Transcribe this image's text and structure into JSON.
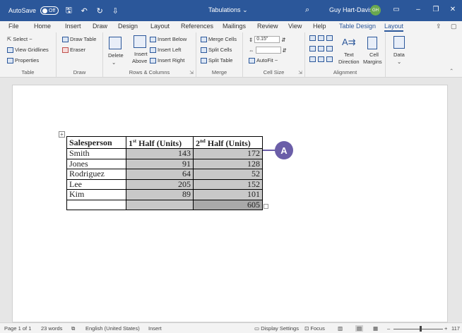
{
  "titlebar": {
    "autosave_label": "AutoSave",
    "autosave_state": "Off",
    "doc_title": "Tabulations",
    "title_suffix": "⌄",
    "user_name": "Guy Hart-Davis",
    "user_initials": "GH",
    "icons": [
      "save-icon",
      "undo-icon",
      "redo-icon",
      "customize-icon"
    ]
  },
  "menu": {
    "tabs": [
      "File",
      "Home",
      "Insert",
      "Draw",
      "Design",
      "Layout",
      "References",
      "Mailings",
      "Review",
      "View",
      "Help",
      "Table Design",
      "Layout"
    ],
    "active_index": 12
  },
  "ribbon": {
    "table": {
      "label": "Table",
      "select": "Select ~",
      "view_gridlines": "View Gridlines",
      "properties": "Properties"
    },
    "draw": {
      "label": "Draw",
      "draw_table": "Draw Table",
      "eraser": "Eraser"
    },
    "rows_columns": {
      "label": "Rows & Columns",
      "delete": "Delete",
      "insert_above_1": "Insert",
      "insert_above_2": "Above",
      "insert_below": "Insert Below",
      "insert_left": "Insert Left",
      "insert_right": "Insert Right"
    },
    "merge": {
      "label": "Merge",
      "merge_cells": "Merge Cells",
      "split_cells": "Split Cells",
      "split_table": "Split Table"
    },
    "cell_size": {
      "label": "Cell Size",
      "height_value": "0.15\"",
      "width_value": "",
      "autofit": "AutoFit ~"
    },
    "alignment": {
      "label": "Alignment",
      "text_direction_1": "Text",
      "text_direction_2": "Direction",
      "cell_margins_1": "Cell",
      "cell_margins_2": "Margins"
    },
    "data": {
      "label": "Data"
    }
  },
  "table": {
    "headers": [
      "Salesperson",
      "1",
      "st",
      " Half (Units)",
      "2",
      "nd",
      " Half (Units)"
    ],
    "rows": [
      [
        "Smith",
        "143",
        "172"
      ],
      [
        "Jones",
        "91",
        "128"
      ],
      [
        "Rodriguez",
        "64",
        "52"
      ],
      [
        "Lee",
        "205",
        "152"
      ],
      [
        "Kim",
        "89",
        "101"
      ],
      [
        "",
        "",
        "605"
      ]
    ]
  },
  "callout": {
    "label": "A",
    "color": "#6b5ea8"
  },
  "statusbar": {
    "page": "Page 1 of 1",
    "words": "23 words",
    "language": "English (United States)",
    "mode": "Insert",
    "display_settings": "Display Settings",
    "focus": "Focus",
    "zoom": "117"
  },
  "colors": {
    "titlebar": "#2b579a",
    "selection": "#c8c8c8"
  }
}
